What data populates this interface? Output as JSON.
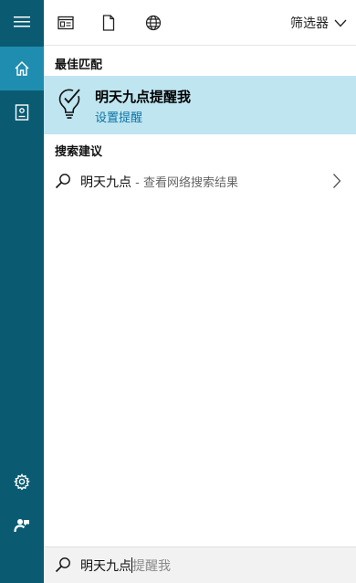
{
  "rail": {
    "items": [
      {
        "name": "menu",
        "icon": "hamburger-icon"
      },
      {
        "name": "home",
        "icon": "home-icon",
        "active": true
      },
      {
        "name": "notebook",
        "icon": "notebook-icon"
      },
      {
        "name": "settings",
        "icon": "gear-icon"
      },
      {
        "name": "feedback",
        "icon": "feedback-icon"
      }
    ]
  },
  "toolbar": {
    "filters": [
      "apps-icon",
      "document-icon",
      "globe-icon"
    ],
    "filter_label": "筛选器"
  },
  "results": {
    "best_match_header": "最佳匹配",
    "best_match": {
      "title": "明天九点提醒我",
      "subtitle": "设置提醒",
      "icon": "lightbulb-check-icon"
    },
    "suggestions_header": "搜索建议",
    "suggestion": {
      "query": "明天九点",
      "hint": " - 查看网络搜索结果"
    }
  },
  "search": {
    "typed": "明天九点",
    "autocomplete": "提醒我"
  },
  "colors": {
    "rail": "#0a5b72",
    "rail_active": "#1f8db0",
    "best_match_bg": "#bfe5f0",
    "link": "#0b73a5"
  }
}
